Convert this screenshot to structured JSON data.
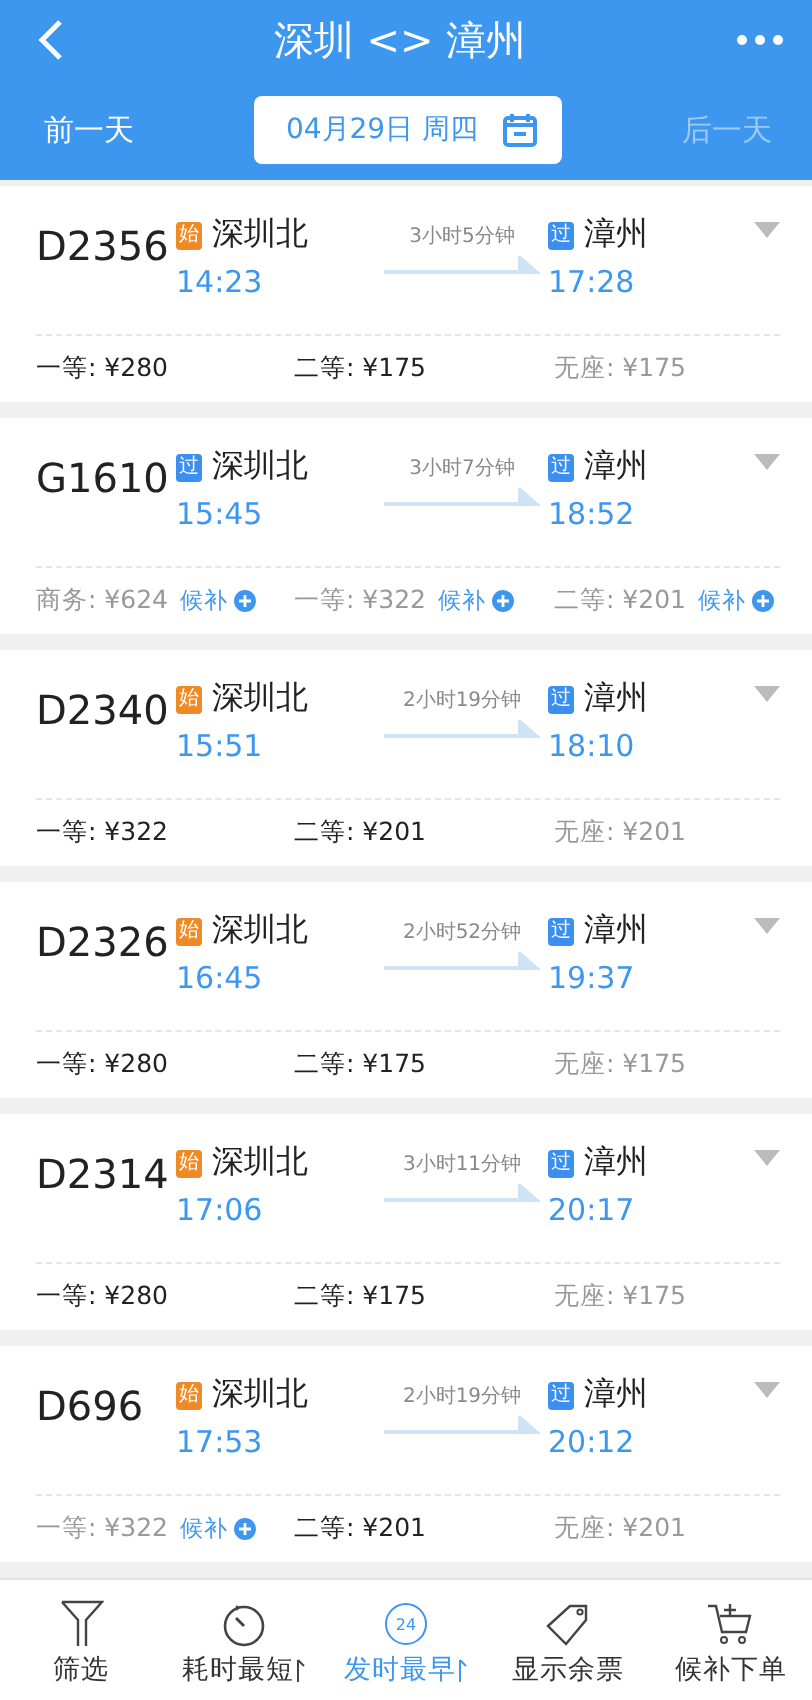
{
  "header": {
    "title": "深圳 <> 漳州",
    "prev_day": "前一天",
    "date": "04月29日 周四",
    "next_day": {
      "label": "后一天",
      "disabled": true
    }
  },
  "trains": [
    {
      "number": "D2356",
      "from": {
        "badge": "始",
        "kind": "start",
        "station": "深圳北",
        "time": "14:23"
      },
      "duration": "3小时5分钟",
      "to": {
        "badge": "过",
        "kind": "pass",
        "station": "漳州",
        "time": "17:28"
      },
      "seats": [
        {
          "text": "一等: ¥280",
          "available": true
        },
        {
          "text": "二等: ¥175",
          "available": true
        },
        {
          "text": "无座: ¥175",
          "available": false
        }
      ]
    },
    {
      "number": "G1610",
      "from": {
        "badge": "过",
        "kind": "pass",
        "station": "深圳北",
        "time": "15:45"
      },
      "duration": "3小时7分钟",
      "to": {
        "badge": "过",
        "kind": "pass",
        "station": "漳州",
        "time": "18:52"
      },
      "seats": [
        {
          "text": "商务: ¥624",
          "available": false,
          "waitlist": "候补"
        },
        {
          "text": "一等: ¥322",
          "available": false,
          "waitlist": "候补"
        },
        {
          "text": "二等: ¥201",
          "available": false,
          "waitlist": "候补"
        }
      ]
    },
    {
      "number": "D2340",
      "from": {
        "badge": "始",
        "kind": "start",
        "station": "深圳北",
        "time": "15:51"
      },
      "duration": "2小时19分钟",
      "to": {
        "badge": "过",
        "kind": "pass",
        "station": "漳州",
        "time": "18:10"
      },
      "seats": [
        {
          "text": "一等: ¥322",
          "available": true
        },
        {
          "text": "二等: ¥201",
          "available": true
        },
        {
          "text": "无座: ¥201",
          "available": false
        }
      ]
    },
    {
      "number": "D2326",
      "from": {
        "badge": "始",
        "kind": "start",
        "station": "深圳北",
        "time": "16:45"
      },
      "duration": "2小时52分钟",
      "to": {
        "badge": "过",
        "kind": "pass",
        "station": "漳州",
        "time": "19:37"
      },
      "seats": [
        {
          "text": "一等: ¥280",
          "available": true
        },
        {
          "text": "二等: ¥175",
          "available": true
        },
        {
          "text": "无座: ¥175",
          "available": false
        }
      ]
    },
    {
      "number": "D2314",
      "from": {
        "badge": "始",
        "kind": "start",
        "station": "深圳北",
        "time": "17:06"
      },
      "duration": "3小时11分钟",
      "to": {
        "badge": "过",
        "kind": "pass",
        "station": "漳州",
        "time": "20:17"
      },
      "seats": [
        {
          "text": "一等: ¥280",
          "available": true
        },
        {
          "text": "二等: ¥175",
          "available": true
        },
        {
          "text": "无座: ¥175",
          "available": false
        }
      ]
    },
    {
      "number": "D696",
      "from": {
        "badge": "始",
        "kind": "start",
        "station": "深圳北",
        "time": "17:53"
      },
      "duration": "2小时19分钟",
      "to": {
        "badge": "过",
        "kind": "pass",
        "station": "漳州",
        "time": "20:12"
      },
      "seats": [
        {
          "text": "一等: ¥322",
          "available": false,
          "waitlist": "候补"
        },
        {
          "text": "二等: ¥201",
          "available": true
        },
        {
          "text": "无座: ¥201",
          "available": false
        }
      ]
    }
  ],
  "toolbar": [
    {
      "label": "筛选",
      "kind": "filter",
      "selected": false
    },
    {
      "label": "耗时最短",
      "kind": "duration",
      "selected": false
    },
    {
      "label": "发时最早",
      "kind": "depart",
      "icon_text": "24",
      "selected": true
    },
    {
      "label": "显示余票",
      "kind": "tickets",
      "selected": false
    },
    {
      "label": "候补下单",
      "kind": "cart",
      "selected": false
    }
  ]
}
